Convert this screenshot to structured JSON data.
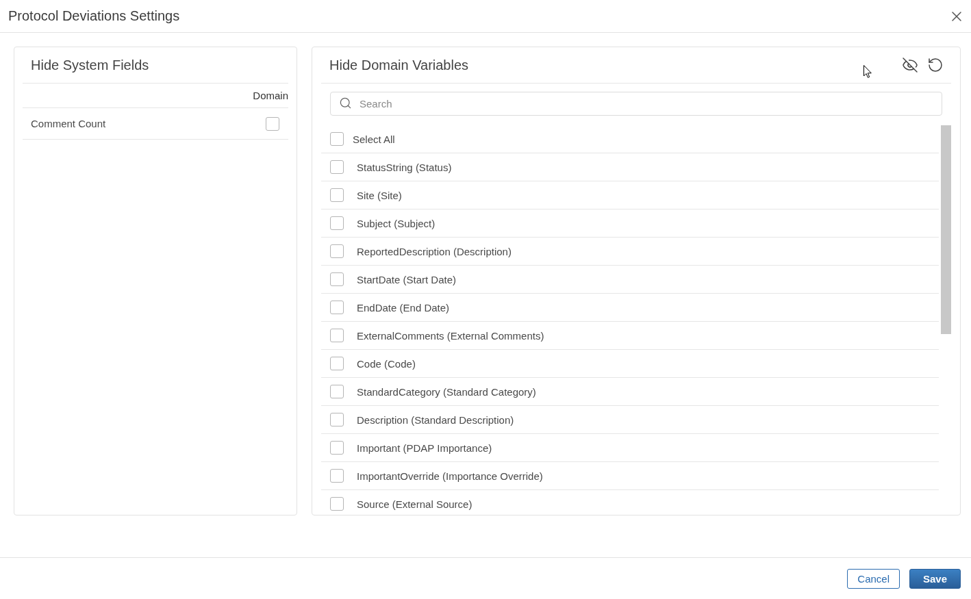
{
  "dialog": {
    "title": "Protocol Deviations Settings"
  },
  "system_fields": {
    "title": "Hide System Fields",
    "column": "Domain",
    "rows": [
      {
        "label": "Comment Count",
        "checked": false
      }
    ]
  },
  "domain_variables": {
    "title": "Hide Domain Variables",
    "search": {
      "placeholder": "Search"
    },
    "select_all": {
      "label": "Select All",
      "checked": false
    },
    "items": [
      {
        "label": "StatusString (Status)",
        "checked": false
      },
      {
        "label": "Site (Site)",
        "checked": false
      },
      {
        "label": "Subject (Subject)",
        "checked": false
      },
      {
        "label": "ReportedDescription (Description)",
        "checked": false
      },
      {
        "label": "StartDate (Start Date)",
        "checked": false
      },
      {
        "label": "EndDate (End Date)",
        "checked": false
      },
      {
        "label": "ExternalComments (External Comments)",
        "checked": false
      },
      {
        "label": "Code (Code)",
        "checked": false
      },
      {
        "label": "StandardCategory (Standard Category)",
        "checked": false
      },
      {
        "label": "Description (Standard Description)",
        "checked": false
      },
      {
        "label": "Important (PDAP Importance)",
        "checked": false
      },
      {
        "label": "ImportantOverride (Importance Override)",
        "checked": false
      },
      {
        "label": "Source (External Source)",
        "checked": false
      }
    ]
  },
  "buttons": [
    {
      "label": "Cancel",
      "kind": "secondary"
    },
    {
      "label": "Save",
      "kind": "primary"
    }
  ]
}
